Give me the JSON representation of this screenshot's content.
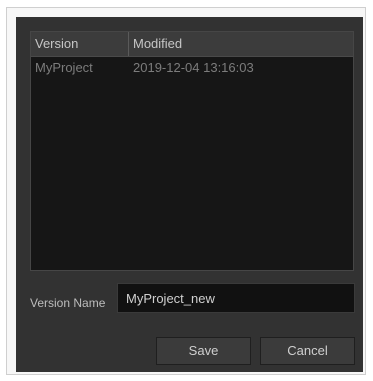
{
  "table": {
    "columns": [
      "Version",
      "Modified"
    ],
    "rows": [
      {
        "version": "MyProject",
        "modified": "2019-12-04 13:16:03"
      }
    ]
  },
  "version_name": {
    "label": "Version Name",
    "value": "MyProject_new"
  },
  "buttons": {
    "save": "Save",
    "cancel": "Cancel"
  },
  "colors": {
    "dialog_bg": "#323232",
    "table_bg": "#161616",
    "header_bg": "#3c3c3c"
  }
}
